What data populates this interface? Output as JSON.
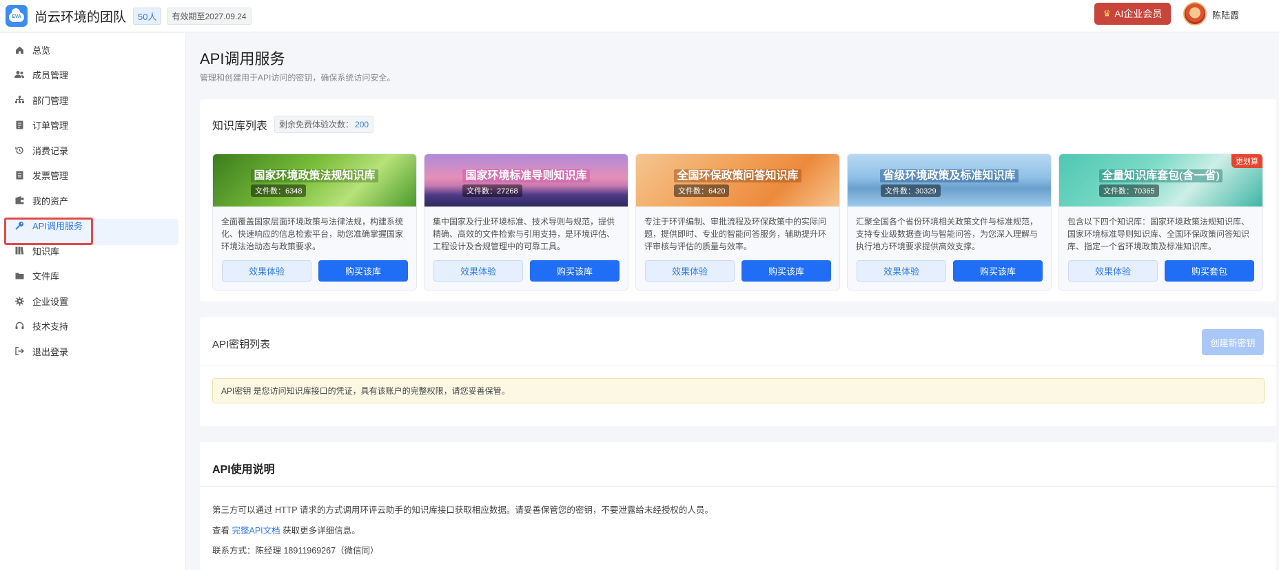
{
  "header": {
    "logo_text": "EVA",
    "team_name": "尚云环境的团队",
    "members_badge": "50人",
    "expiry_badge": "有效期至2027.09.24",
    "vip_label": "AI企业会员",
    "user_name": "陈陆霞"
  },
  "sidebar": {
    "items": [
      {
        "label": "总览",
        "icon": "home-icon"
      },
      {
        "label": "成员管理",
        "icon": "users-icon"
      },
      {
        "label": "部门管理",
        "icon": "org-icon"
      },
      {
        "label": "订单管理",
        "icon": "order-icon"
      },
      {
        "label": "消费记录",
        "icon": "history-icon"
      },
      {
        "label": "发票管理",
        "icon": "invoice-icon"
      },
      {
        "label": "我的资产",
        "icon": "wallet-icon"
      },
      {
        "label": "API调用服务",
        "icon": "key-icon"
      },
      {
        "label": "知识库",
        "icon": "book-icon"
      },
      {
        "label": "文件库",
        "icon": "folder-icon"
      },
      {
        "label": "企业设置",
        "icon": "gear-icon"
      },
      {
        "label": "技术支持",
        "icon": "headset-icon"
      },
      {
        "label": "退出登录",
        "icon": "logout-icon"
      }
    ],
    "active_index": 7
  },
  "page": {
    "title": "API调用服务",
    "subtitle": "管理和创建用于API访问的密钥，确保系统访问安全。"
  },
  "knowledge": {
    "title": "知识库列表",
    "trial_label": "剩余免费体验次数：",
    "trial_count": "200",
    "cards": [
      {
        "title": "国家环境政策法规知识库",
        "count": "文件数：6348",
        "desc": "全面覆盖国家层面环境政策与法律法规，构建系统化、快速响应的信息检索平台，助您准确掌握国家环境法治动态与政策要求。",
        "try_label": "效果体验",
        "buy_label": "购买该库"
      },
      {
        "title": "国家环境标准导则知识库",
        "count": "文件数：27268",
        "desc": "集中国家及行业环境标准、技术导则与规范，提供精确、高效的文件检索与引用支持，是环境评估、工程设计及合规管理中的可靠工具。",
        "try_label": "效果体验",
        "buy_label": "购买该库"
      },
      {
        "title": "全国环保政策问答知识库",
        "count": "文件数：6420",
        "desc": "专注于环评编制、审批流程及环保政策中的实际问题，提供即时、专业的智能问答服务，辅助提升环评审核与评估的质量与效率。",
        "try_label": "效果体验",
        "buy_label": "购买该库"
      },
      {
        "title": "省级环境政策及标准知识库",
        "count": "文件数：30329",
        "desc": "汇聚全国各个省份环境相关政策文件与标准规范，支持专业级数据查询与智能问答，为您深入理解与执行地方环境要求提供高效支撑。",
        "try_label": "效果体验",
        "buy_label": "购买该库"
      },
      {
        "title": "全量知识库套包(含一省)",
        "count": "文件数：70365",
        "desc": "包含以下四个知识库：国家环境政策法规知识库、国家环境标准导则知识库、全国环保政策问答知识库、指定一个省环境政策及标准知识库。",
        "try_label": "效果体验",
        "buy_label": "购买套包",
        "ribbon": "更划算"
      }
    ]
  },
  "keys": {
    "title": "API密钥列表",
    "create_label": "创建新密钥",
    "warning": "API密钥 是您访问知识库接口的凭证，具有该账户的完整权限，请您妥善保管。"
  },
  "usage": {
    "title": "API使用说明",
    "line1": "第三方可以通过 HTTP 请求的方式调用环评云助手的知识库接口获取相应数据。请妥善保管您的密钥，不要泄露给未经授权的人员。",
    "line2_prefix": "查看 ",
    "line2_link": "完整API文档",
    "line2_suffix": " 获取更多详细信息。",
    "line3": "联系方式：陈经理 18911969267（微信同）"
  }
}
